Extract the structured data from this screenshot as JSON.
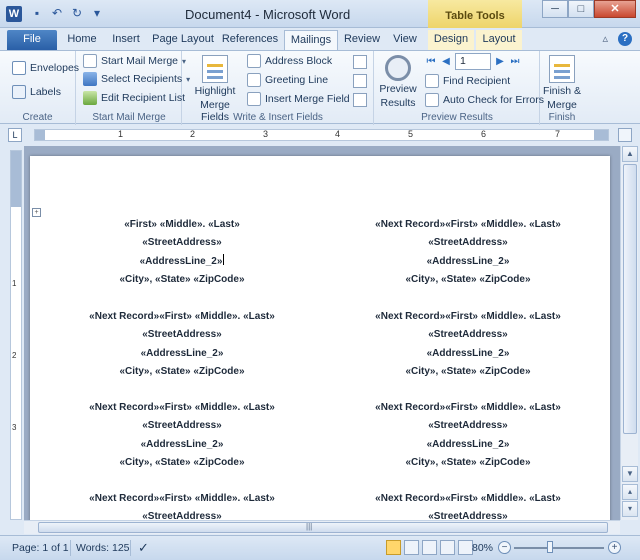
{
  "window": {
    "title": "Document4 - Microsoft Word",
    "contextual_tab_group": "Table Tools",
    "app_icon_letter": "W",
    "min_label": "─",
    "max_label": "□",
    "close_label": "✕"
  },
  "tabs": [
    {
      "label": "File"
    },
    {
      "label": "Home"
    },
    {
      "label": "Insert"
    },
    {
      "label": "Page Layout"
    },
    {
      "label": "References"
    },
    {
      "label": "Mailings"
    },
    {
      "label": "Review"
    },
    {
      "label": "View"
    },
    {
      "label": "Design"
    },
    {
      "label": "Layout"
    }
  ],
  "active_tab": "Mailings",
  "ribbon": {
    "create": {
      "label": "Create",
      "envelopes": "Envelopes",
      "labels": "Labels"
    },
    "start_mail_merge": {
      "label": "Start Mail Merge",
      "start_mail_merge": "Start Mail Merge",
      "select_recipients": "Select Recipients",
      "edit_recipient_list": "Edit Recipient List"
    },
    "write_insert": {
      "label": "Write & Insert Fields",
      "highlight_merge_fields_1": "Highlight",
      "highlight_merge_fields_2": "Merge Fields",
      "address_block": "Address Block",
      "greeting_line": "Greeting Line",
      "insert_merge_field": "Insert Merge Field"
    },
    "preview": {
      "label": "Preview Results",
      "preview_results_1": "Preview",
      "preview_results_2": "Results",
      "record_number": "1",
      "find_recipient": "Find Recipient",
      "auto_check": "Auto Check for Errors"
    },
    "finish": {
      "label": "Finish",
      "finish_merge_1": "Finish &",
      "finish_merge_2": "Merge"
    }
  },
  "ruler": {
    "tab_selector": "L",
    "numbers": [
      "1",
      "2",
      "3",
      "4",
      "5",
      "6",
      "7"
    ],
    "vertical_numbers": [
      "1",
      "2",
      "3"
    ]
  },
  "document": {
    "labels": [
      {
        "line1": "«First» «Middle». «Last»",
        "line2": "«StreetAddress»",
        "line3": "«AddressLine_2»",
        "line4": "«City», «State» «ZipCode»"
      },
      {
        "line1": "«Next Record»«First» «Middle». «Last»",
        "line2": "«StreetAddress»",
        "line3": "«AddressLine_2»",
        "line4": "«City», «State» «ZipCode»"
      },
      {
        "line1": "«Next Record»«First» «Middle». «Last»",
        "line2": "«StreetAddress»",
        "line3": "«AddressLine_2»",
        "line4": "«City», «State» «ZipCode»"
      },
      {
        "line1": "«Next Record»«First» «Middle». «Last»",
        "line2": "«StreetAddress»",
        "line3": "«AddressLine_2»",
        "line4": "«City», «State» «ZipCode»"
      },
      {
        "line1": "«Next Record»«First» «Middle». «Last»",
        "line2": "«StreetAddress»",
        "line3": "«AddressLine_2»",
        "line4": "«City», «State» «ZipCode»"
      },
      {
        "line1": "«Next Record»«First» «Middle». «Last»",
        "line2": "«StreetAddress»",
        "line3": "«AddressLine_2»",
        "line4": "«City», «State» «ZipCode»"
      },
      {
        "line1": "«Next Record»«First» «Middle». «Last»",
        "line2": "«StreetAddress»"
      },
      {
        "line1": "«Next Record»«First» «Middle». «Last»",
        "line2": "«StreetAddress»"
      }
    ]
  },
  "status": {
    "page": "Page: 1 of 1",
    "words": "Words: 125",
    "zoom": "80%",
    "zoom_out": "−",
    "zoom_in": "+"
  },
  "colors": {
    "accent": "#2b579a",
    "table_tools": "#eed46a",
    "close": "#c9472f"
  }
}
